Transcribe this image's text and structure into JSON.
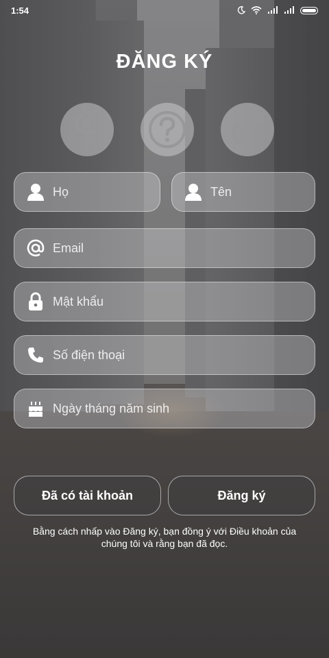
{
  "status_bar": {
    "time": "1:54"
  },
  "title": "ĐĂNG KÝ",
  "gender": {
    "female_icon": "female-symbol-icon",
    "unknown_icon": "question-mark-icon",
    "male_icon": "male-symbol-icon"
  },
  "fields": {
    "last_name": {
      "placeholder": "Họ",
      "icon": "person-icon"
    },
    "first_name": {
      "placeholder": "Tên",
      "icon": "person-icon"
    },
    "email": {
      "placeholder": "Email",
      "icon": "at-icon"
    },
    "password": {
      "placeholder": "Mật khẩu",
      "icon": "lock-icon"
    },
    "phone": {
      "placeholder": "Số điện thoại",
      "icon": "phone-icon"
    },
    "birthday": {
      "placeholder": "Ngày tháng năm sinh",
      "icon": "cake-icon"
    }
  },
  "buttons": {
    "have_account": "Đã có tài khoản",
    "register": "Đăng ký"
  },
  "terms": "Bằng cách nhấp vào Đăng ký, bạn đồng ý với Điều khoản của chúng tôi và rằng bạn đã đọc."
}
